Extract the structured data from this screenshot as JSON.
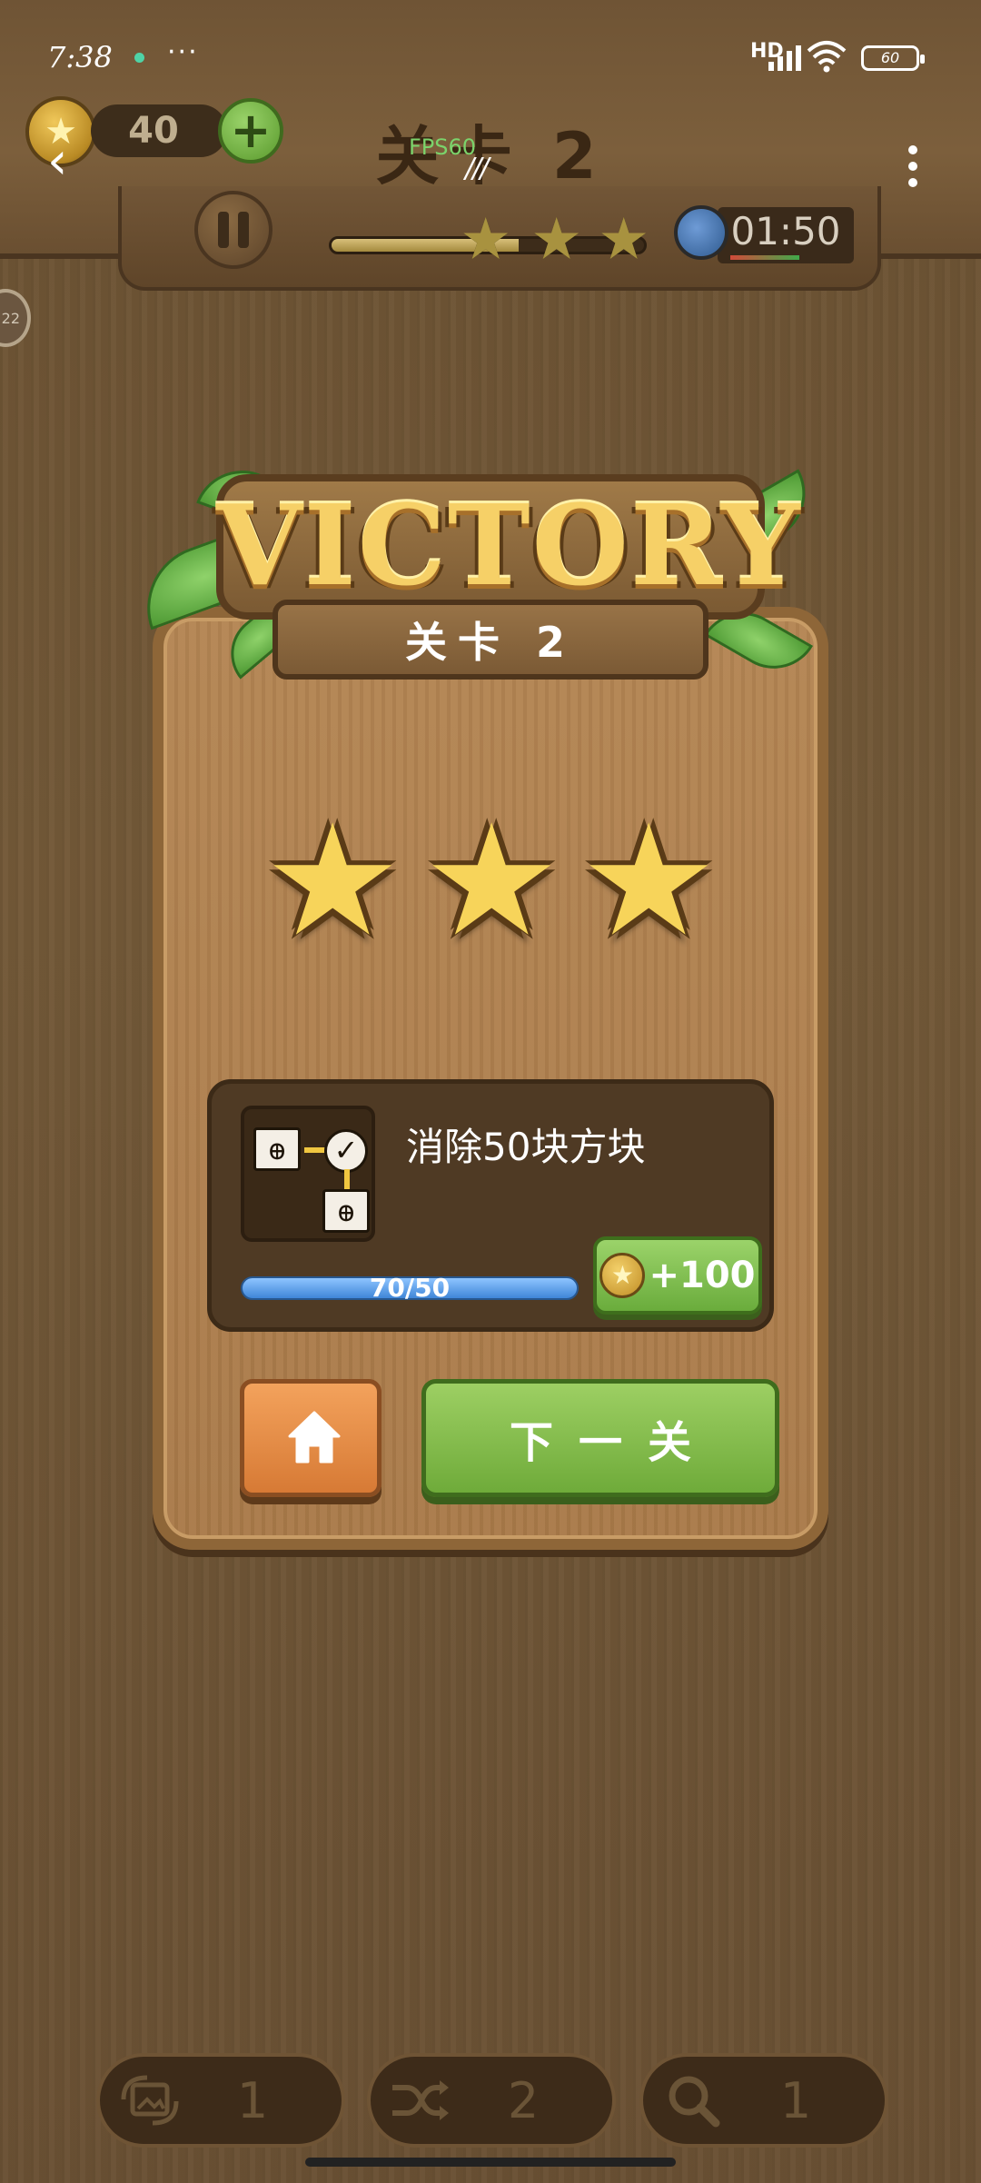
{
  "status_bar": {
    "time": "7:38",
    "more": "···",
    "network": "HD",
    "battery": "60"
  },
  "header": {
    "coins": "40",
    "plus_label": "+",
    "level_title": "关卡 2",
    "fps_label": "FPS60",
    "timer": "01:50",
    "progress_fraction": 0.6,
    "stars_earned": 3,
    "side_badge": "22"
  },
  "victory": {
    "title": "VICTORY",
    "subtitle": "关卡  2",
    "stars": 3
  },
  "task": {
    "description": "消除50块方块",
    "progress_text": "70/50",
    "progress_fraction": 1.0,
    "reward": "+100"
  },
  "buttons": {
    "next_label": "下一关"
  },
  "tools": [
    {
      "icon": "rotate-image-icon",
      "count": "1"
    },
    {
      "icon": "shuffle-icon",
      "count": "2"
    },
    {
      "icon": "search-icon",
      "count": "1"
    }
  ],
  "colors": {
    "wood": "#735938",
    "card": "#b08050",
    "green_button": "#7db64a",
    "orange_button": "#e48a42",
    "star_gold": "#f7d45a"
  }
}
